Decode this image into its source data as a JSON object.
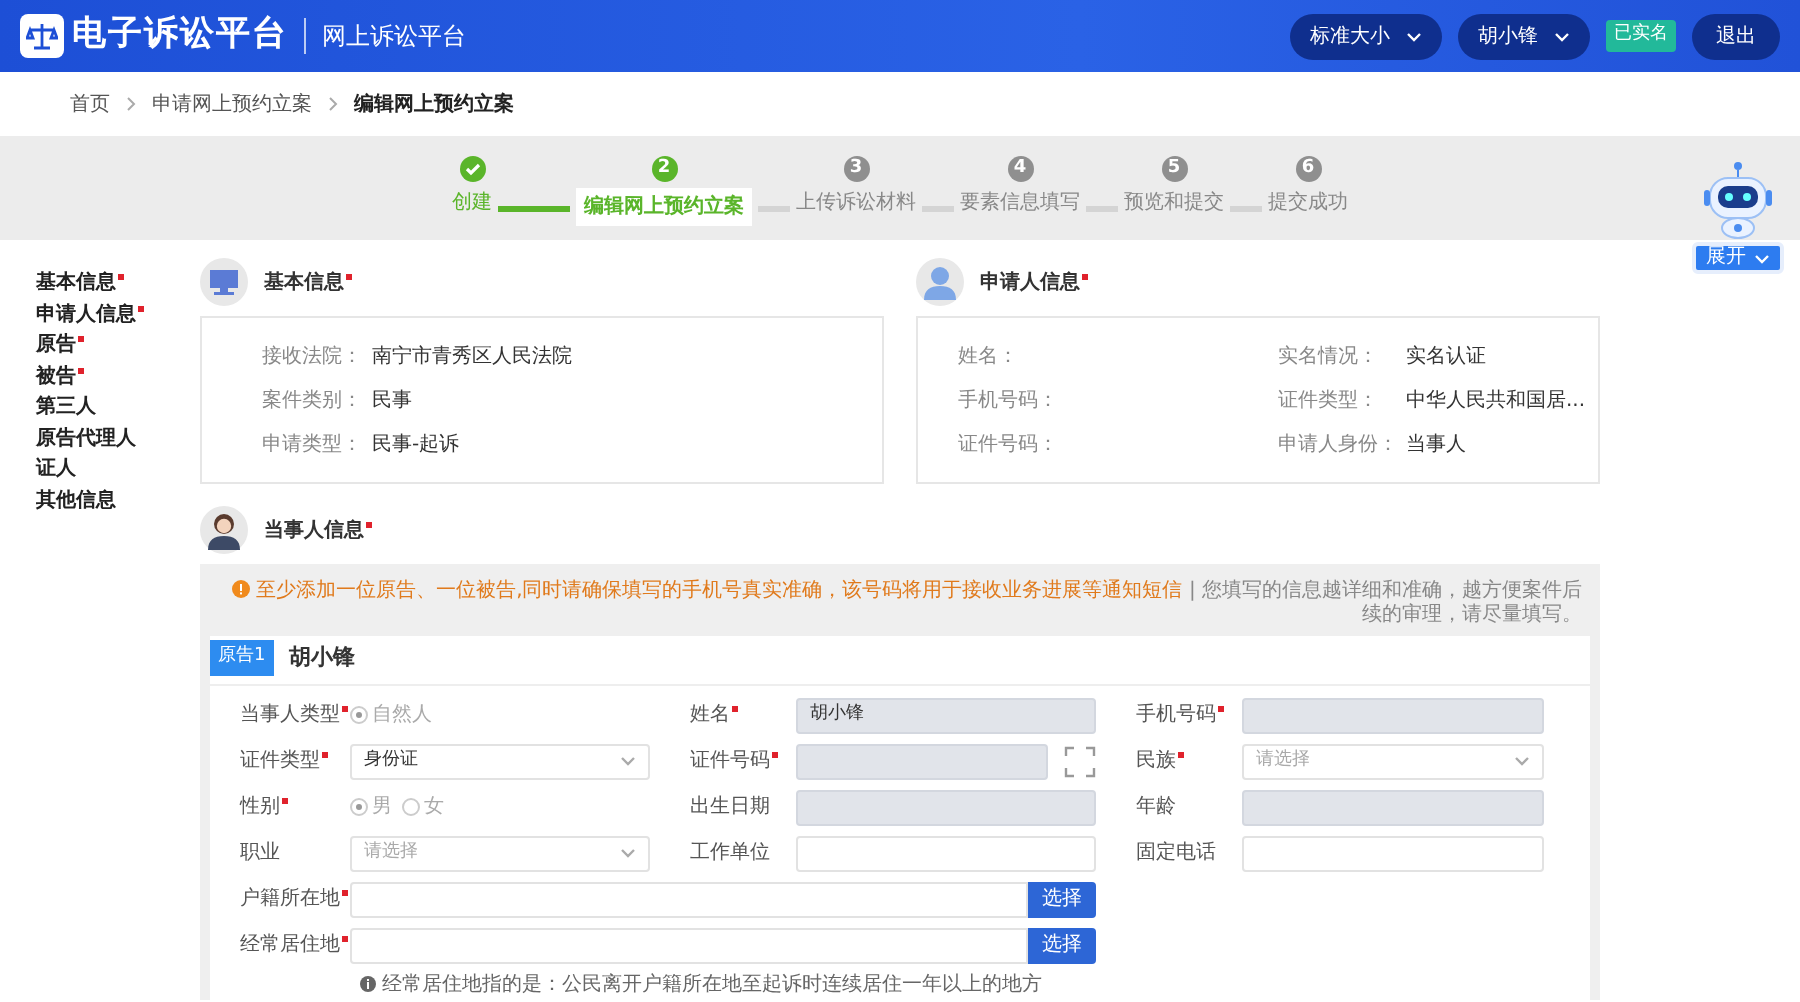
{
  "header": {
    "title": "电子诉讼平台",
    "subtitle": "网上诉讼平台",
    "size_menu": "标准大小",
    "user_menu": "胡小锋",
    "verified_badge": "已实名",
    "logout": "退出"
  },
  "breadcrumb": [
    {
      "label": "首页",
      "current": false
    },
    {
      "label": "申请网上预约立案",
      "current": false
    },
    {
      "label": "编辑网上预约立案",
      "current": true
    }
  ],
  "steps": [
    {
      "label": "创建",
      "completed": true,
      "selected": false
    },
    {
      "number": "2",
      "label": "编辑网上预约立案",
      "completed": false,
      "selected": true
    },
    {
      "number": "3",
      "label": "上传诉讼材料",
      "completed": false,
      "selected": false
    },
    {
      "number": "4",
      "label": "要素信息填写",
      "completed": false,
      "selected": false
    },
    {
      "number": "5",
      "label": "预览和提交",
      "completed": false,
      "selected": false
    },
    {
      "number": "6",
      "label": "提交成功",
      "completed": false,
      "selected": false
    }
  ],
  "assistant": {
    "button": "展开"
  },
  "side_nav": [
    {
      "label": "基本信息",
      "required": true
    },
    {
      "label": "申请人信息",
      "required": true
    },
    {
      "label": "原告",
      "required": true
    },
    {
      "label": "被告",
      "required": true
    },
    {
      "label": "第三人",
      "required": false
    },
    {
      "label": "原告代理人",
      "required": false
    },
    {
      "label": "证人",
      "required": false
    },
    {
      "label": "其他信息",
      "required": false
    }
  ],
  "basic_info": {
    "title": "基本信息",
    "required": true,
    "fields": [
      {
        "label": "接收法院：",
        "value": "南宁市青秀区人民法院"
      },
      {
        "label": "案件类别：",
        "value": "民事"
      },
      {
        "label": "申请类型：",
        "value": "民事-起诉"
      }
    ]
  },
  "applicant_info": {
    "title": "申请人信息",
    "required": true,
    "fields": [
      {
        "label": "姓名："
      },
      {
        "label": "实名情况：",
        "value": "实名认证"
      },
      {
        "label": "手机号码："
      },
      {
        "label": "证件类型：",
        "value": "中华人民共和国居..."
      },
      {
        "label": "证件号码："
      },
      {
        "label": "申请人身份：",
        "value": "当事人"
      }
    ]
  },
  "party_info": {
    "title": "当事人信息",
    "required": true,
    "notice": "至少添加一位原告、一位被告,同时请确保填写的手机号真实准确，该号码将用于接收业务进展等通知短信",
    "notice_extra": "| 您填写的信息越详细和准确，越方便案件后续的审理，请尽量填写。",
    "party_tag": "原告1",
    "party_name": "胡小锋",
    "form": [
      {
        "kind": "radio",
        "label": "当事人类型",
        "required": true,
        "options": [
          {
            "label": "自然人",
            "selected": true
          }
        ]
      },
      {
        "kind": "text",
        "label": "姓名",
        "required": true,
        "value": "胡小锋",
        "disabled": true
      },
      {
        "kind": "text",
        "label": "手机号码",
        "required": true,
        "disabled": true
      },
      {
        "kind": "select",
        "label": "证件类型",
        "required": true,
        "value": "身份证"
      },
      {
        "kind": "scan",
        "label": "证件号码",
        "required": true,
        "disabled": true
      },
      {
        "kind": "select",
        "label": "民族",
        "required": true,
        "placeholder": "请选择"
      },
      {
        "kind": "radio",
        "label": "性别",
        "required": true,
        "options": [
          {
            "label": "男",
            "selected": true
          },
          {
            "label": "女",
            "selected": false
          }
        ]
      },
      {
        "kind": "text",
        "label": "出生日期",
        "required": false,
        "disabled": true
      },
      {
        "kind": "text",
        "label": "年龄",
        "required": false,
        "disabled": true
      },
      {
        "kind": "select",
        "label": "职业",
        "required": false,
        "placeholder": "请选择"
      },
      {
        "kind": "text",
        "label": "工作单位",
        "required": false,
        "disabled": false
      },
      {
        "kind": "text",
        "label": "固定电话",
        "required": false,
        "disabled": false
      },
      {
        "kind": "picker",
        "label": "户籍所在地",
        "required": true,
        "button": "选择"
      },
      {
        "kind": "picker",
        "label": "经常居住地",
        "required": true,
        "button": "选择"
      }
    ],
    "residence_note": "经常居住地指的是：公民离开户籍所在地至起诉时连续居住一年以上的地方"
  }
}
